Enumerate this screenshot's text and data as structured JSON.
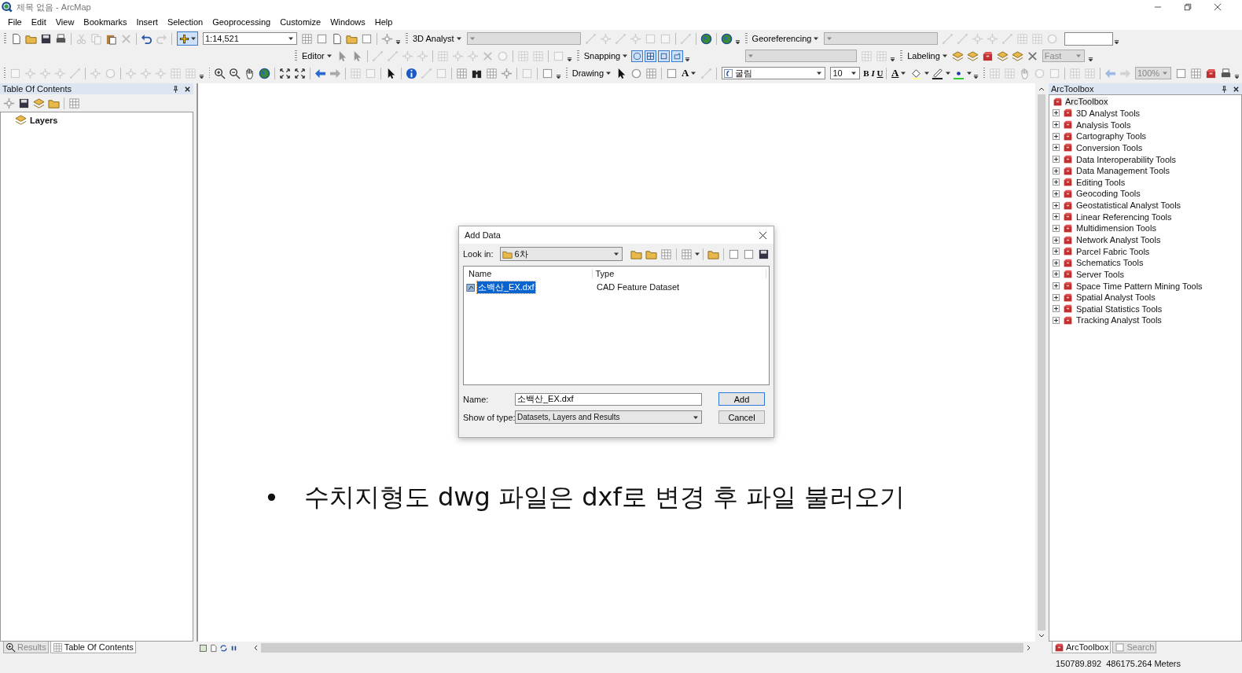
{
  "window": {
    "title": "제목 없음 - ArcMap"
  },
  "menu": [
    "File",
    "Edit",
    "View",
    "Bookmarks",
    "Insert",
    "Selection",
    "Geoprocessing",
    "Customize",
    "Windows",
    "Help"
  ],
  "toolbars": {
    "scale": "1:14,521",
    "analyst_3d": "3D Analyst",
    "georeferencing": "Georeferencing",
    "editor": "Editor",
    "snapping": "Snapping",
    "snapping_buttons": [
      {
        "on": true
      },
      {
        "on": true
      },
      {
        "on": true
      },
      {
        "on": true
      }
    ],
    "labeling": "Labeling",
    "label_quality": {
      "value": "Fast",
      "disabled": true
    },
    "drawing": "Drawing",
    "text_tool": "A",
    "font": "굴림",
    "font_size": "10",
    "format_buttons": [
      "B",
      "I",
      "U"
    ],
    "font_color": "A",
    "zoom": "100%"
  },
  "table_of_contents": {
    "title": "Table Of Contents",
    "layers": [
      "Layers"
    ],
    "tabs": [
      {
        "label": "Results",
        "selected": false
      },
      {
        "label": "Table Of Contents",
        "selected": true
      }
    ]
  },
  "map": {
    "bullet": "•",
    "text": "수치지형도 dwg 파일은 dxf로 변경 후 파일 불러오기"
  },
  "dialog": {
    "title": "Add Data",
    "look_in_label": "Look in:",
    "look_in": "6차",
    "columns": [
      "Name",
      "Type"
    ],
    "files": [
      {
        "name": "소백산_EX.dxf",
        "type": "CAD Feature Dataset",
        "selected": true
      }
    ],
    "name_label": "Name:",
    "name_value": "소백산_EX.dxf",
    "type_label": "Show of type:",
    "type_value": "Datasets, Layers and Results",
    "buttons": [
      "Add",
      "Cancel"
    ]
  },
  "toolbox": {
    "title": "ArcToolbox",
    "root": {
      "label": "ArcToolbox",
      "selected": true
    },
    "items": [
      {
        "label": "3D Analyst Tools",
        "expanded": false
      },
      {
        "label": "Analysis Tools",
        "expanded": false
      },
      {
        "label": "Cartography Tools",
        "expanded": false
      },
      {
        "label": "Conversion Tools",
        "expanded": false
      },
      {
        "label": "Data Interoperability Tools",
        "expanded": false
      },
      {
        "label": "Data Management Tools",
        "expanded": false
      },
      {
        "label": "Editing Tools",
        "expanded": false
      },
      {
        "label": "Geocoding Tools",
        "expanded": false
      },
      {
        "label": "Geostatistical Analyst Tools",
        "expanded": false
      },
      {
        "label": "Linear Referencing Tools",
        "expanded": false
      },
      {
        "label": "Multidimension Tools",
        "expanded": false
      },
      {
        "label": "Network Analyst Tools",
        "expanded": false
      },
      {
        "label": "Parcel Fabric Tools",
        "expanded": false
      },
      {
        "label": "Schematics Tools",
        "expanded": false
      },
      {
        "label": "Server Tools",
        "expanded": false
      },
      {
        "label": "Space Time Pattern Mining Tools",
        "expanded": false
      },
      {
        "label": "Spatial Analyst Tools",
        "expanded": false
      },
      {
        "label": "Spatial Statistics Tools",
        "expanded": false
      },
      {
        "label": "Tracking Analyst Tools",
        "expanded": false
      }
    ],
    "tabs": [
      {
        "label": "ArcToolbox",
        "selected": true
      },
      {
        "label": "Search",
        "selected": false
      }
    ]
  },
  "status_bar": {
    "coordinates": "150789.892  486175.264 Meters"
  }
}
